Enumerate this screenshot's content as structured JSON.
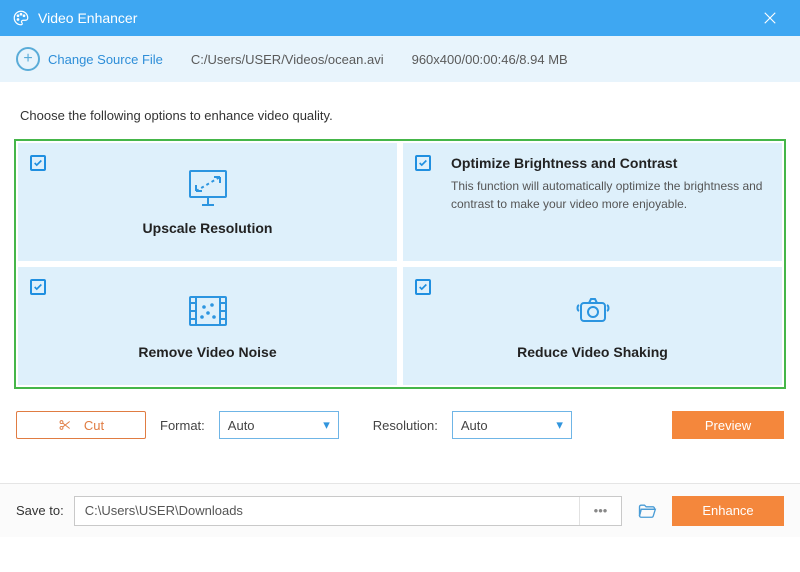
{
  "titlebar": {
    "title": "Video Enhancer"
  },
  "infobar": {
    "change_label": "Change Source File",
    "path": "C:/Users/USER/Videos/ocean.avi",
    "meta": "960x400/00:00:46/8.94 MB"
  },
  "instruction": "Choose the following options to enhance video quality.",
  "options": {
    "upscale": {
      "title": "Upscale Resolution"
    },
    "optimize": {
      "title": "Optimize Brightness and Contrast",
      "desc": "This function will automatically optimize the brightness and contrast to make your video more enjoyable."
    },
    "noise": {
      "title": "Remove Video Noise"
    },
    "shake": {
      "title": "Reduce Video Shaking"
    }
  },
  "controls": {
    "cut_label": "Cut",
    "format_label": "Format:",
    "format_value": "Auto",
    "resolution_label": "Resolution:",
    "resolution_value": "Auto",
    "preview_label": "Preview"
  },
  "save": {
    "label": "Save to:",
    "path": "C:\\Users\\USER\\Downloads",
    "enhance_label": "Enhance"
  }
}
